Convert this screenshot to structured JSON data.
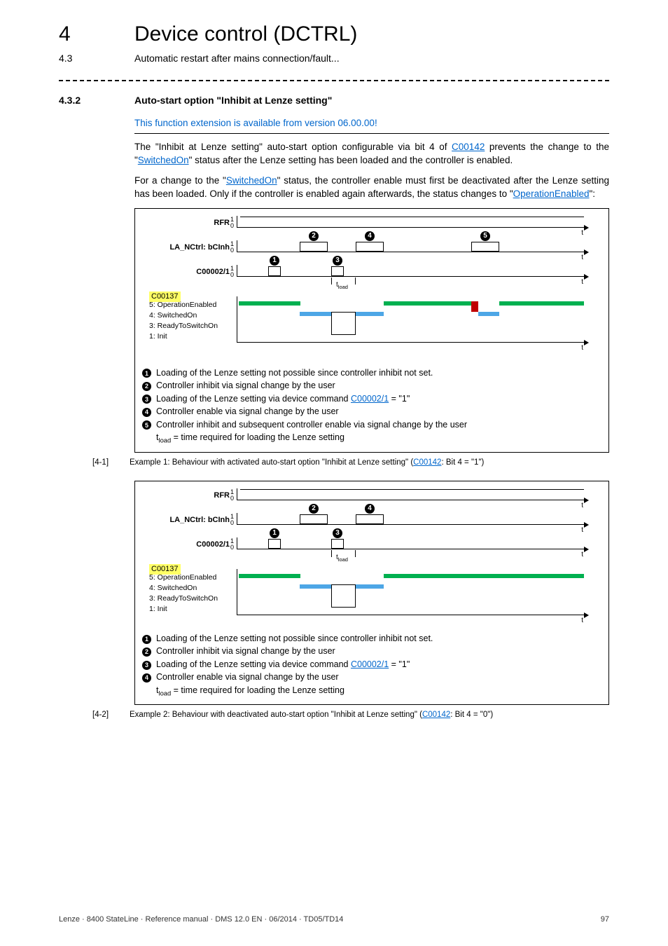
{
  "header": {
    "chapter_num": "4",
    "chapter_title": "Device control (DCTRL)",
    "section_num": "4.3",
    "section_title": "Automatic restart after mains connection/fault..."
  },
  "section": {
    "num": "4.3.2",
    "title": "Auto-start option \"Inhibit at Lenze setting\"",
    "availability": "This function extension is available from version 06.00.00!",
    "para1_a": "The  \"Inhibit at Lenze setting\" auto-start option configurable via bit 4 of ",
    "para1_link1": "C00142",
    "para1_b": " prevents the change to the \"",
    "para1_link2": "SwitchedOn",
    "para1_c": "\" status after the Lenze setting has been loaded and the controller is enabled.",
    "para2_a": "For a change to the \"",
    "para2_link1": "SwitchedOn",
    "para2_b": "\" status, the controller enable must first be deactivated after the Lenze setting has been loaded. Only if the controller is enabled again afterwards, the status changes to \"",
    "para2_link2": "OperationEnabled",
    "para2_c": "\":"
  },
  "diagram_common": {
    "sig_rfr": "RFR",
    "sig_lanc": "LA_NCtrl: bCInh",
    "sig_c2": "C00002/1",
    "sig_c137": "C00137",
    "tick1": "1",
    "tick0": "0",
    "t": "t",
    "tload": "tload",
    "st5": "5: OperationEnabled",
    "st4": "4: SwitchedOn",
    "st3": "3: ReadyToSwitchOn",
    "st1": "1: Init"
  },
  "legend1": {
    "l1": "Loading of the Lenze setting not possible since controller inhibit not set.",
    "l2": "Controller inhibit via signal change by the user",
    "l3a": "Loading of the Lenze setting via device command ",
    "l3link": "C00002/1",
    "l3b": " = \"1\"",
    "l4": "Controller enable via signal change by the user",
    "l5": "Controller inhibit and subsequent controller enable via signal change by the user",
    "tload_a": "t",
    "tload_b": " = time required for loading the Lenze setting"
  },
  "caption1": {
    "ref": "[4-1]",
    "text_a": "Example 1: Behaviour with activated auto-start option \"Inhibit at Lenze setting\" (",
    "link": "C00142",
    "text_b": ": Bit 4 = \"1\")"
  },
  "legend2": {
    "l1": "Loading of the Lenze setting not possible since controller inhibit not set.",
    "l2": "Controller inhibit via signal change by the user",
    "l3a": "Loading of the Lenze setting via device command ",
    "l3link": "C00002/1",
    "l3b": " = \"1\"",
    "l4": "Controller enable via signal change by the user",
    "tload_a": "t",
    "tload_b": " = time required for loading the Lenze setting"
  },
  "caption2": {
    "ref": "[4-2]",
    "text_a": "Example 2: Behaviour with deactivated auto-start option \"Inhibit at Lenze setting\" (",
    "link": "C00142",
    "text_b": ": Bit 4 = \"0\")"
  },
  "footer": {
    "left": "Lenze · 8400 StateLine · Reference manual · DMS 12.0 EN · 06/2014 · TD05/TD14",
    "right": "97"
  },
  "chart_data": [
    {
      "type": "timing-diagram",
      "title": "Example 1: auto-start option enabled (C00142 Bit4=1)",
      "signals": [
        {
          "name": "RFR",
          "type": "digital",
          "levels": [
            "0",
            "1"
          ],
          "waveform": "constant 1"
        },
        {
          "name": "LA_NCtrl: bCInh",
          "type": "digital",
          "levels": [
            "0",
            "1"
          ],
          "events": [
            "pulse at 2",
            "pulse at 4",
            "pulse at 5"
          ]
        },
        {
          "name": "C00002/1",
          "type": "digital",
          "levels": [
            "0",
            "1"
          ],
          "events": [
            "pulse at 1",
            "pulse at 3 (duration t_load)"
          ]
        },
        {
          "name": "C00137",
          "type": "state",
          "states": [
            "1: Init",
            "3: ReadyToSwitchOn",
            "4: SwitchedOn",
            "5: OperationEnabled"
          ],
          "sequence": [
            "5: OperationEnabled",
            "4: SwitchedOn (after 2)",
            "1: Init (during t_load after 3)",
            "4: SwitchedOn (brief, after 4)",
            "4: SwitchedOn (no auto-op since bit4=1, red marker)",
            "5: OperationEnabled (after user re-enable 5)"
          ]
        }
      ],
      "annotations": [
        "1",
        "2",
        "3",
        "4",
        "5"
      ],
      "tload_marker": true
    },
    {
      "type": "timing-diagram",
      "title": "Example 2: auto-start option disabled (C00142 Bit4=0)",
      "signals": [
        {
          "name": "RFR",
          "type": "digital",
          "levels": [
            "0",
            "1"
          ],
          "waveform": "constant 1"
        },
        {
          "name": "LA_NCtrl: bCInh",
          "type": "digital",
          "levels": [
            "0",
            "1"
          ],
          "events": [
            "pulse at 2",
            "pulse at 4"
          ]
        },
        {
          "name": "C00002/1",
          "type": "digital",
          "levels": [
            "0",
            "1"
          ],
          "events": [
            "pulse at 1",
            "pulse at 3 (duration t_load)"
          ]
        },
        {
          "name": "C00137",
          "type": "state",
          "states": [
            "1: Init",
            "3: ReadyToSwitchOn",
            "4: SwitchedOn",
            "5: OperationEnabled"
          ],
          "sequence": [
            "5: OperationEnabled",
            "4: SwitchedOn (after 2)",
            "1: Init (during t_load after 3)",
            "5: OperationEnabled (after 4, auto since bit4=0)"
          ]
        }
      ],
      "annotations": [
        "1",
        "2",
        "3",
        "4"
      ],
      "tload_marker": true
    }
  ]
}
